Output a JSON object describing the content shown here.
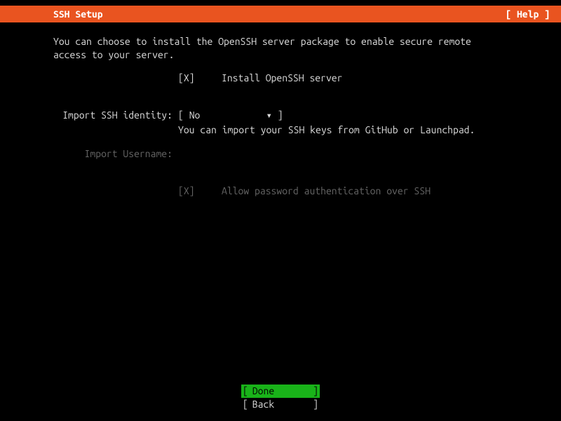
{
  "header": {
    "title": "SSH Setup",
    "help": "[ Help ]"
  },
  "description": "You can choose to install the OpenSSH server package to enable secure remote access to your server.",
  "install_openssh": {
    "checkbox": "[X]",
    "label": "Install OpenSSH server"
  },
  "import_identity": {
    "label": "Import SSH identity:",
    "value_bracket_open": "[",
    "value": "No",
    "value_arrow": "▾",
    "value_bracket_close": "]",
    "hint": "You can import your SSH keys from GitHub or Launchpad."
  },
  "import_username": {
    "label": "Import Username:"
  },
  "allow_password": {
    "checkbox": "[X]",
    "label": "Allow password authentication over SSH"
  },
  "footer": {
    "done": "Done",
    "back": "Back"
  }
}
